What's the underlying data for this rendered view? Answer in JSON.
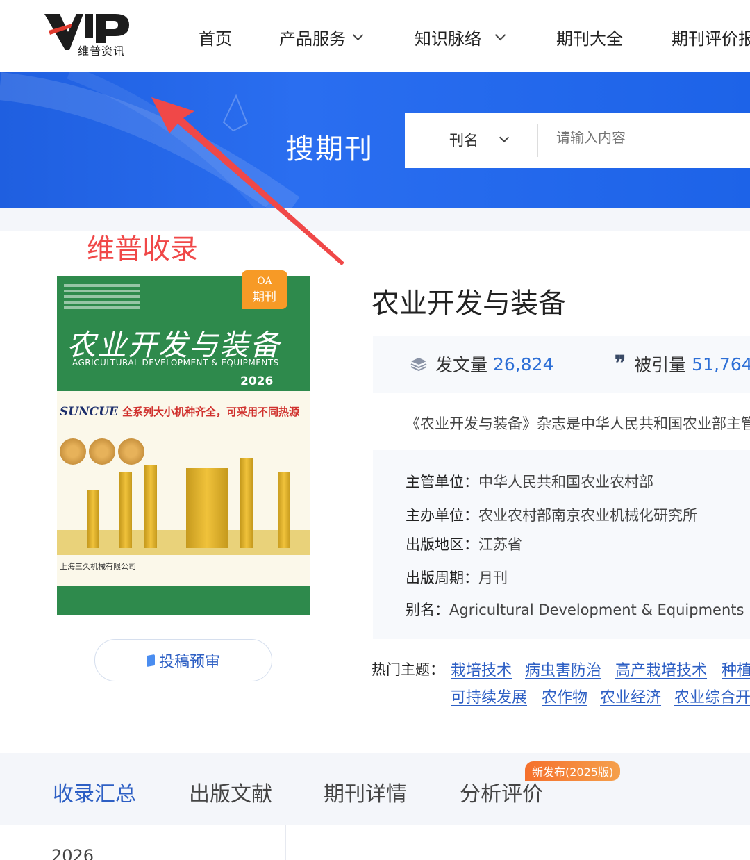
{
  "header": {
    "logo_text": "维普资讯",
    "nav": [
      {
        "label": "首页",
        "has_dropdown": false
      },
      {
        "label": "产品服务",
        "has_dropdown": true
      },
      {
        "label": "知识脉络",
        "has_dropdown": true
      },
      {
        "label": "期刊大全",
        "has_dropdown": false
      },
      {
        "label": "期刊评价报告",
        "has_dropdown": false
      }
    ]
  },
  "banner": {
    "title": "搜期刊",
    "search": {
      "select_value": "刊名",
      "placeholder": "请输入内容"
    }
  },
  "annotation": {
    "text": "维普收录",
    "color": "#f04848"
  },
  "cover": {
    "badge_line1": "OA",
    "badge_line2": "期刊",
    "title": "农业开发与装备",
    "subtitle": "AGRICULTURAL DEVELOPMENT & EQUIPMENTS",
    "year": "2026",
    "ad_brand": "SUNCUE",
    "ad_text": "全系列大小机种齐全，可采用不同热源",
    "company": "上海三久机械有限公司"
  },
  "submit_button": {
    "label": "投稿预审"
  },
  "journal": {
    "title": "农业开发与装备",
    "stats": {
      "articles_label": "发文量",
      "articles_value": "26,824",
      "citations_label": "被引量",
      "citations_value": "51,764"
    },
    "description": "《农业开发与装备》杂志是中华人民共和国农业部主管",
    "info": [
      {
        "key": "主管单位：",
        "value": "中华人民共和国农业农村部"
      },
      {
        "key": "主办单位：",
        "value": "农业农村部南京农业机械化研究所"
      },
      {
        "key": "出版地区：",
        "value": "江苏省"
      },
      {
        "key": "出版周期：",
        "value": "月刊"
      },
      {
        "key": "别名：",
        "value": "Agricultural Development & Equipments"
      }
    ],
    "topics_label": "热门主题：",
    "topics": [
      "栽培技术",
      "病虫害防治",
      "高产栽培技术",
      "种植技术",
      "可持续发展",
      "农作物",
      "农业经济",
      "农业综合开发"
    ]
  },
  "tabs": {
    "items": [
      "收录汇总",
      "出版文献",
      "期刊详情",
      "分析评价"
    ],
    "active_index": 0,
    "new_badge": "新发布(2025版)"
  },
  "bottom": {
    "year": "2026"
  },
  "colors": {
    "brand_blue": "#2d5fc4",
    "banner_blue": "#2a6ef0",
    "cover_green": "#2e8a4c",
    "badge_orange": "#f79a26"
  }
}
